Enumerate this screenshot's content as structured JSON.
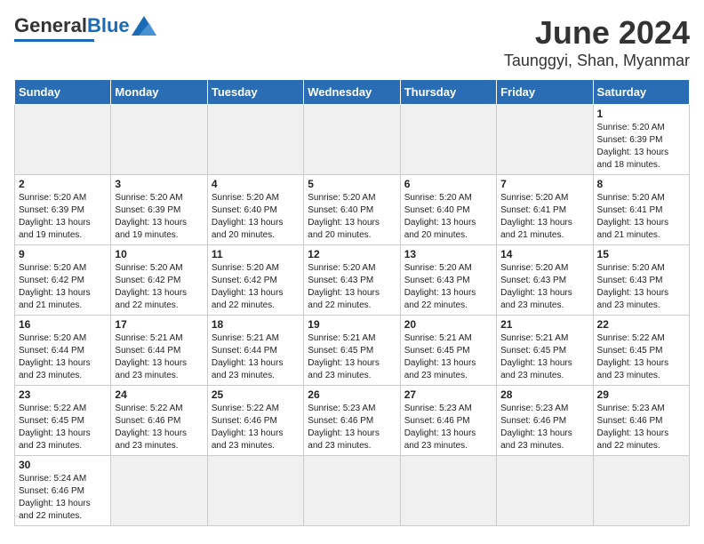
{
  "header": {
    "logo_general": "General",
    "logo_blue": "Blue",
    "title": "June 2024",
    "subtitle": "Taunggyi, Shan, Myanmar"
  },
  "days": [
    "Sunday",
    "Monday",
    "Tuesday",
    "Wednesday",
    "Thursday",
    "Friday",
    "Saturday"
  ],
  "weeks": [
    [
      {
        "date": "",
        "empty": true
      },
      {
        "date": "",
        "empty": true
      },
      {
        "date": "",
        "empty": true
      },
      {
        "date": "",
        "empty": true
      },
      {
        "date": "",
        "empty": true
      },
      {
        "date": "",
        "empty": true
      },
      {
        "date": "1",
        "sunrise": "5:20 AM",
        "sunset": "6:39 PM",
        "daylight": "13 hours and 18 minutes."
      }
    ],
    [
      {
        "date": "2",
        "sunrise": "5:20 AM",
        "sunset": "6:39 PM",
        "daylight": "13 hours and 19 minutes."
      },
      {
        "date": "3",
        "sunrise": "5:20 AM",
        "sunset": "6:39 PM",
        "daylight": "13 hours and 19 minutes."
      },
      {
        "date": "4",
        "sunrise": "5:20 AM",
        "sunset": "6:40 PM",
        "daylight": "13 hours and 20 minutes."
      },
      {
        "date": "5",
        "sunrise": "5:20 AM",
        "sunset": "6:40 PM",
        "daylight": "13 hours and 20 minutes."
      },
      {
        "date": "6",
        "sunrise": "5:20 AM",
        "sunset": "6:40 PM",
        "daylight": "13 hours and 20 minutes."
      },
      {
        "date": "7",
        "sunrise": "5:20 AM",
        "sunset": "6:41 PM",
        "daylight": "13 hours and 21 minutes."
      },
      {
        "date": "8",
        "sunrise": "5:20 AM",
        "sunset": "6:41 PM",
        "daylight": "13 hours and 21 minutes."
      }
    ],
    [
      {
        "date": "9",
        "sunrise": "5:20 AM",
        "sunset": "6:42 PM",
        "daylight": "13 hours and 21 minutes."
      },
      {
        "date": "10",
        "sunrise": "5:20 AM",
        "sunset": "6:42 PM",
        "daylight": "13 hours and 22 minutes."
      },
      {
        "date": "11",
        "sunrise": "5:20 AM",
        "sunset": "6:42 PM",
        "daylight": "13 hours and 22 minutes."
      },
      {
        "date": "12",
        "sunrise": "5:20 AM",
        "sunset": "6:43 PM",
        "daylight": "13 hours and 22 minutes."
      },
      {
        "date": "13",
        "sunrise": "5:20 AM",
        "sunset": "6:43 PM",
        "daylight": "13 hours and 22 minutes."
      },
      {
        "date": "14",
        "sunrise": "5:20 AM",
        "sunset": "6:43 PM",
        "daylight": "13 hours and 23 minutes."
      },
      {
        "date": "15",
        "sunrise": "5:20 AM",
        "sunset": "6:43 PM",
        "daylight": "13 hours and 23 minutes."
      }
    ],
    [
      {
        "date": "16",
        "sunrise": "5:20 AM",
        "sunset": "6:44 PM",
        "daylight": "13 hours and 23 minutes."
      },
      {
        "date": "17",
        "sunrise": "5:21 AM",
        "sunset": "6:44 PM",
        "daylight": "13 hours and 23 minutes."
      },
      {
        "date": "18",
        "sunrise": "5:21 AM",
        "sunset": "6:44 PM",
        "daylight": "13 hours and 23 minutes."
      },
      {
        "date": "19",
        "sunrise": "5:21 AM",
        "sunset": "6:45 PM",
        "daylight": "13 hours and 23 minutes."
      },
      {
        "date": "20",
        "sunrise": "5:21 AM",
        "sunset": "6:45 PM",
        "daylight": "13 hours and 23 minutes."
      },
      {
        "date": "21",
        "sunrise": "5:21 AM",
        "sunset": "6:45 PM",
        "daylight": "13 hours and 23 minutes."
      },
      {
        "date": "22",
        "sunrise": "5:22 AM",
        "sunset": "6:45 PM",
        "daylight": "13 hours and 23 minutes."
      }
    ],
    [
      {
        "date": "23",
        "sunrise": "5:22 AM",
        "sunset": "6:45 PM",
        "daylight": "13 hours and 23 minutes."
      },
      {
        "date": "24",
        "sunrise": "5:22 AM",
        "sunset": "6:46 PM",
        "daylight": "13 hours and 23 minutes."
      },
      {
        "date": "25",
        "sunrise": "5:22 AM",
        "sunset": "6:46 PM",
        "daylight": "13 hours and 23 minutes."
      },
      {
        "date": "26",
        "sunrise": "5:23 AM",
        "sunset": "6:46 PM",
        "daylight": "13 hours and 23 minutes."
      },
      {
        "date": "27",
        "sunrise": "5:23 AM",
        "sunset": "6:46 PM",
        "daylight": "13 hours and 23 minutes."
      },
      {
        "date": "28",
        "sunrise": "5:23 AM",
        "sunset": "6:46 PM",
        "daylight": "13 hours and 23 minutes."
      },
      {
        "date": "29",
        "sunrise": "5:23 AM",
        "sunset": "6:46 PM",
        "daylight": "13 hours and 22 minutes."
      }
    ],
    [
      {
        "date": "30",
        "sunrise": "5:24 AM",
        "sunset": "6:46 PM",
        "daylight": "13 hours and 22 minutes."
      },
      {
        "date": "",
        "empty": true
      },
      {
        "date": "",
        "empty": true
      },
      {
        "date": "",
        "empty": true
      },
      {
        "date": "",
        "empty": true
      },
      {
        "date": "",
        "empty": true
      },
      {
        "date": "",
        "empty": true
      }
    ]
  ],
  "labels": {
    "sunrise": "Sunrise:",
    "sunset": "Sunset:",
    "daylight": "Daylight:"
  }
}
